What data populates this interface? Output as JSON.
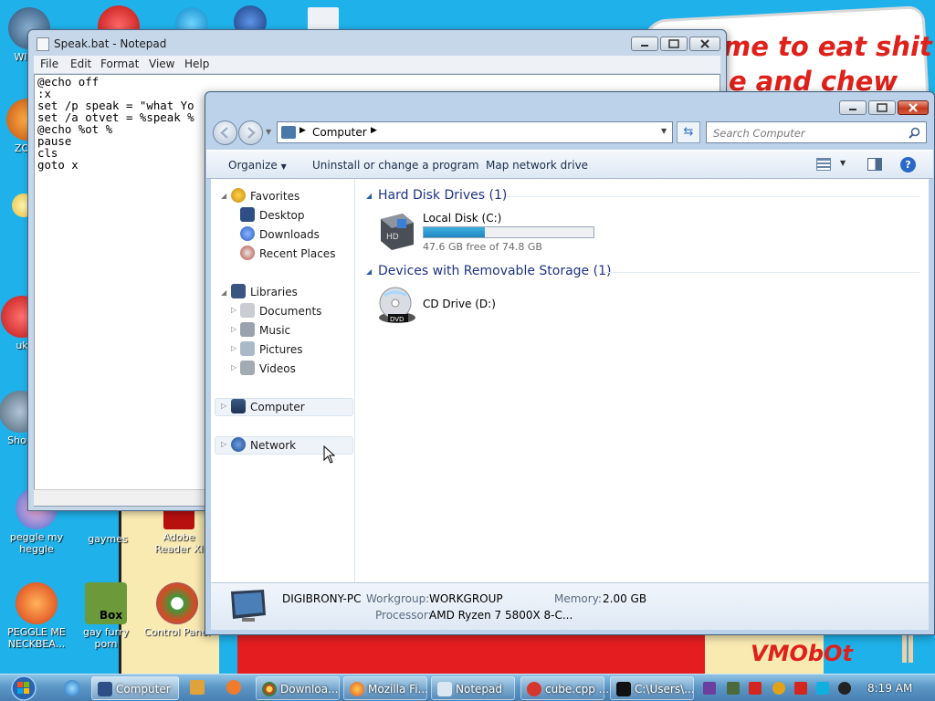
{
  "desktop": {
    "wallpaper_text_1": "me to eat shit",
    "wallpaper_text_2": "e and chew",
    "wallpaper_sig": "VMObOt",
    "icons": [
      {
        "label": "WIN V"
      },
      {
        "label": "ZO D"
      },
      {
        "label": "uk"
      },
      {
        "label": "Shop"
      },
      {
        "label": "peggle my heggle"
      },
      {
        "label": "gaymes"
      },
      {
        "label": "Adobe Reader XI"
      },
      {
        "label": "PEGGLE ME NECKBEA..."
      },
      {
        "label": "gay furry porn"
      },
      {
        "label": "Control Panel"
      }
    ],
    "box_icon_text": "Box"
  },
  "notepad": {
    "title": "Speak.bat - Notepad",
    "menu": [
      "File",
      "Edit",
      "Format",
      "View",
      "Help"
    ],
    "content": "@echo off\n:x\nset /p speak = \"what Yo\nset /a otvet = %speak %\n@echo %ot %\npause\ncls\ngoto x"
  },
  "explorer": {
    "address_segment": "Computer",
    "search_placeholder": "Search Computer",
    "toolbar": {
      "organize": "Organize",
      "uninstall": "Uninstall or change a program",
      "map_drive": "Map network drive"
    },
    "nav": {
      "favorites": "Favorites",
      "desktop": "Desktop",
      "downloads": "Downloads",
      "recent": "Recent Places",
      "libraries": "Libraries",
      "documents": "Documents",
      "music": "Music",
      "pictures": "Pictures",
      "videos": "Videos",
      "computer": "Computer",
      "network": "Network"
    },
    "groups": {
      "hdd": "Hard Disk Drives (1)",
      "removable": "Devices with Removable Storage (1)"
    },
    "local_disk": {
      "name": "Local Disk (C:)",
      "free_text": "47.6 GB free of 74.8 GB",
      "used_fraction": 0.36
    },
    "cd_drive": {
      "name": "CD Drive (D:)",
      "dvd_label": "DVD"
    },
    "details": {
      "pc_name": "DIGIBRONY-PC",
      "workgroup_label": "Workgroup:",
      "workgroup_value": "WORKGROUP",
      "memory_label": "Memory:",
      "memory_value": "2.00 GB",
      "processor_label": "Processor:",
      "processor_value": "AMD Ryzen 7 5800X 8-C..."
    }
  },
  "taskbar": {
    "buttons": [
      {
        "label": "Computer",
        "active": true
      },
      {
        "label": "Downloa..."
      },
      {
        "label": "Mozilla Fi..."
      },
      {
        "label": "Notepad"
      },
      {
        "label": "cube.cpp ..."
      },
      {
        "label": "C:\\Users\\..."
      }
    ],
    "clock": "8:19 AM"
  }
}
